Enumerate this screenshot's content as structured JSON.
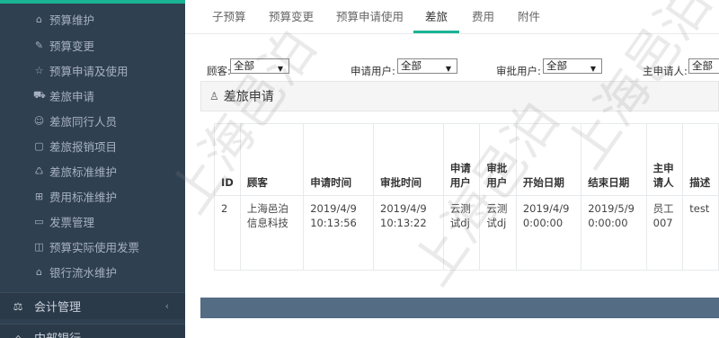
{
  "sidebar": {
    "items": [
      {
        "icon": "home-icon",
        "glyph": "⌂",
        "label": "预算维护"
      },
      {
        "icon": "edit-icon",
        "glyph": "✎",
        "label": "预算变更"
      },
      {
        "icon": "star-icon",
        "glyph": "☆",
        "label": "预算申请及使用"
      },
      {
        "icon": "car-icon",
        "glyph": "⛟",
        "label": "差旅申请"
      },
      {
        "icon": "users-icon",
        "glyph": "☺",
        "label": "差旅同行人员"
      },
      {
        "icon": "doc-icon",
        "glyph": "▢",
        "label": "差旅报销项目"
      },
      {
        "icon": "recycle-icon",
        "glyph": "♺",
        "label": "差旅标准维护"
      },
      {
        "icon": "plus-square-icon",
        "glyph": "⊞",
        "label": "费用标准维护"
      },
      {
        "icon": "invoice-icon",
        "glyph": "▭",
        "label": "发票管理"
      },
      {
        "icon": "map-icon",
        "glyph": "◫",
        "label": "预算实际使用发票"
      },
      {
        "icon": "bank-icon",
        "glyph": "⌂",
        "label": "银行流水维护"
      }
    ],
    "groups": [
      {
        "icon": "balance-icon",
        "glyph": "⚖",
        "label": "会计管理",
        "chevron": "‹"
      },
      {
        "icon": "bank-icon",
        "glyph": "⌂",
        "label": "内部银行",
        "chevron": ""
      }
    ]
  },
  "tabs": [
    "子预算",
    "预算变更",
    "预算申请使用",
    "差旅",
    "费用",
    "附件"
  ],
  "filters": [
    {
      "label": "顾客:",
      "value": "全部"
    },
    {
      "label": "申请用户:",
      "value": "全部"
    },
    {
      "label": "审批用户:",
      "value": "全部"
    },
    {
      "label": "主申请人:",
      "value": "全部"
    }
  ],
  "panel": {
    "icon": "user-icon",
    "glyph": "♙",
    "title": "差旅申请"
  },
  "table": {
    "headers": [
      "ID",
      "顾客",
      "申请时间",
      "审批时间",
      "申请用户",
      "审批用户",
      "开始日期",
      "结束日期",
      "主申请人",
      "描述"
    ],
    "rows": [
      [
        "2",
        "上海邑泊信息科技",
        "2019/4/9 10:13:56",
        "2019/4/9 10:13:22",
        "云测试dj",
        "云测试dj",
        "2019/4/9 0:00:00",
        "2019/5/9 0:00:00",
        "员工007",
        "test"
      ]
    ]
  },
  "watermark": "上海邑泊"
}
